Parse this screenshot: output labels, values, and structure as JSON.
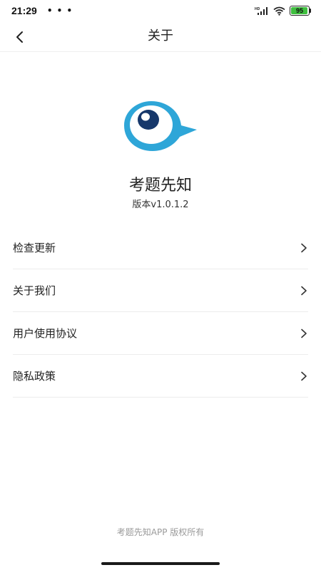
{
  "status_bar": {
    "time": "21:29",
    "more": "• • •",
    "battery": "95",
    "battery_level": 0.95,
    "icons": [
      "hd-icon",
      "signal-icon",
      "wifi-icon",
      "battery-icon"
    ],
    "battery_color": "#3fbf3f"
  },
  "nav": {
    "title": "关于",
    "back_icon": "chevron-left-icon"
  },
  "app": {
    "name": "考题先知",
    "version": "版本v1.0.1.2",
    "logo_colors": {
      "outer": "#2ea6d8",
      "pupil": "#17386b",
      "highlight": "#ffffff"
    }
  },
  "menu": {
    "items": [
      {
        "label": "检查更新",
        "icon": "chevron-right-icon"
      },
      {
        "label": "关于我们",
        "icon": "chevron-right-icon"
      },
      {
        "label": "用户使用协议",
        "icon": "chevron-right-icon"
      },
      {
        "label": "隐私政策",
        "icon": "chevron-right-icon"
      }
    ]
  },
  "footer": {
    "text": "考题先知APP 版权所有"
  }
}
